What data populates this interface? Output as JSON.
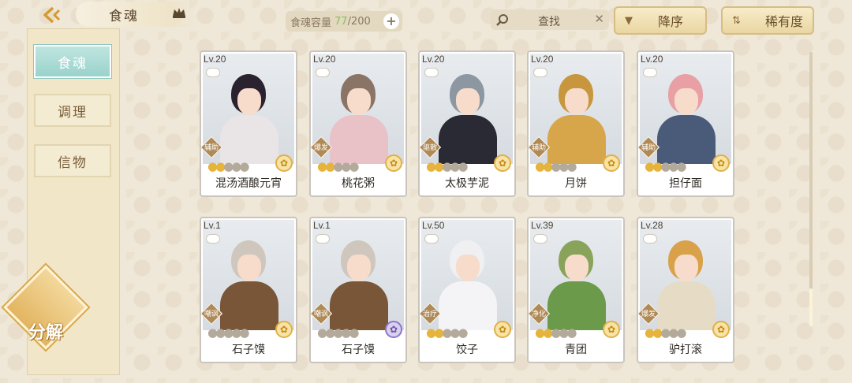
{
  "header": {
    "title": "食魂",
    "capacity_label": "食魂容量",
    "capacity_current": "77",
    "capacity_total": "/200",
    "search_label": "查找",
    "sort_label": "降序",
    "rarity_label": "稀有度"
  },
  "sidebar": {
    "tabs": [
      {
        "label": "食魂",
        "active": true
      },
      {
        "label": "调理",
        "active": false
      },
      {
        "label": "信物",
        "active": false
      }
    ],
    "decompose_label": "分解"
  },
  "cards": [
    {
      "level": "Lv.20",
      "role": "辅助",
      "stars": 2,
      "name": "混汤酒酿元宵",
      "rank": "gold",
      "hair": "#2b2230",
      "outfit": "#e9e4e6"
    },
    {
      "level": "Lv.20",
      "role": "爆发",
      "stars": 2,
      "name": "桃花粥",
      "rank": "gold",
      "hair": "#8a7466",
      "outfit": "#e9c2c8"
    },
    {
      "level": "Lv.20",
      "role": "驱散",
      "stars": 2,
      "name": "太极芋泥",
      "rank": "gold",
      "hair": "#8d97a1",
      "outfit": "#2a2a34"
    },
    {
      "level": "Lv.20",
      "role": "辅助",
      "stars": 2,
      "name": "月饼",
      "rank": "gold",
      "hair": "#c8963e",
      "outfit": "#d8a64a"
    },
    {
      "level": "Lv.20",
      "role": "辅助",
      "stars": 2,
      "name": "担仔面",
      "rank": "gold",
      "hair": "#e8a0a4",
      "outfit": "#4a5b7a"
    },
    {
      "level": "Lv.1",
      "role": "嘲讽",
      "stars": 0,
      "name": "石子馍",
      "rank": "gold",
      "hair": "#cfc7bd",
      "outfit": "#7a5638"
    },
    {
      "level": "Lv.1",
      "role": "嘲讽",
      "stars": 0,
      "name": "石子馍",
      "rank": "purple",
      "hair": "#cfc7bd",
      "outfit": "#7a5638"
    },
    {
      "level": "Lv.50",
      "role": "治疗",
      "stars": 2,
      "name": "饺子",
      "rank": "gold",
      "hair": "#f0f0f2",
      "outfit": "#f4f4f6"
    },
    {
      "level": "Lv.39",
      "role": "净化",
      "stars": 2,
      "name": "青团",
      "rank": "gold",
      "hair": "#8aa35a",
      "outfit": "#6b9a4a"
    },
    {
      "level": "Lv.28",
      "role": "爆发",
      "stars": 2,
      "name": "驴打滚",
      "rank": "gold",
      "hair": "#d9a24a",
      "outfit": "#e6dcc6"
    }
  ],
  "colors": {
    "accent_teal": "#9ad2cc",
    "gold": "#e6b43c",
    "capacity_green": "#8bbf5a"
  }
}
